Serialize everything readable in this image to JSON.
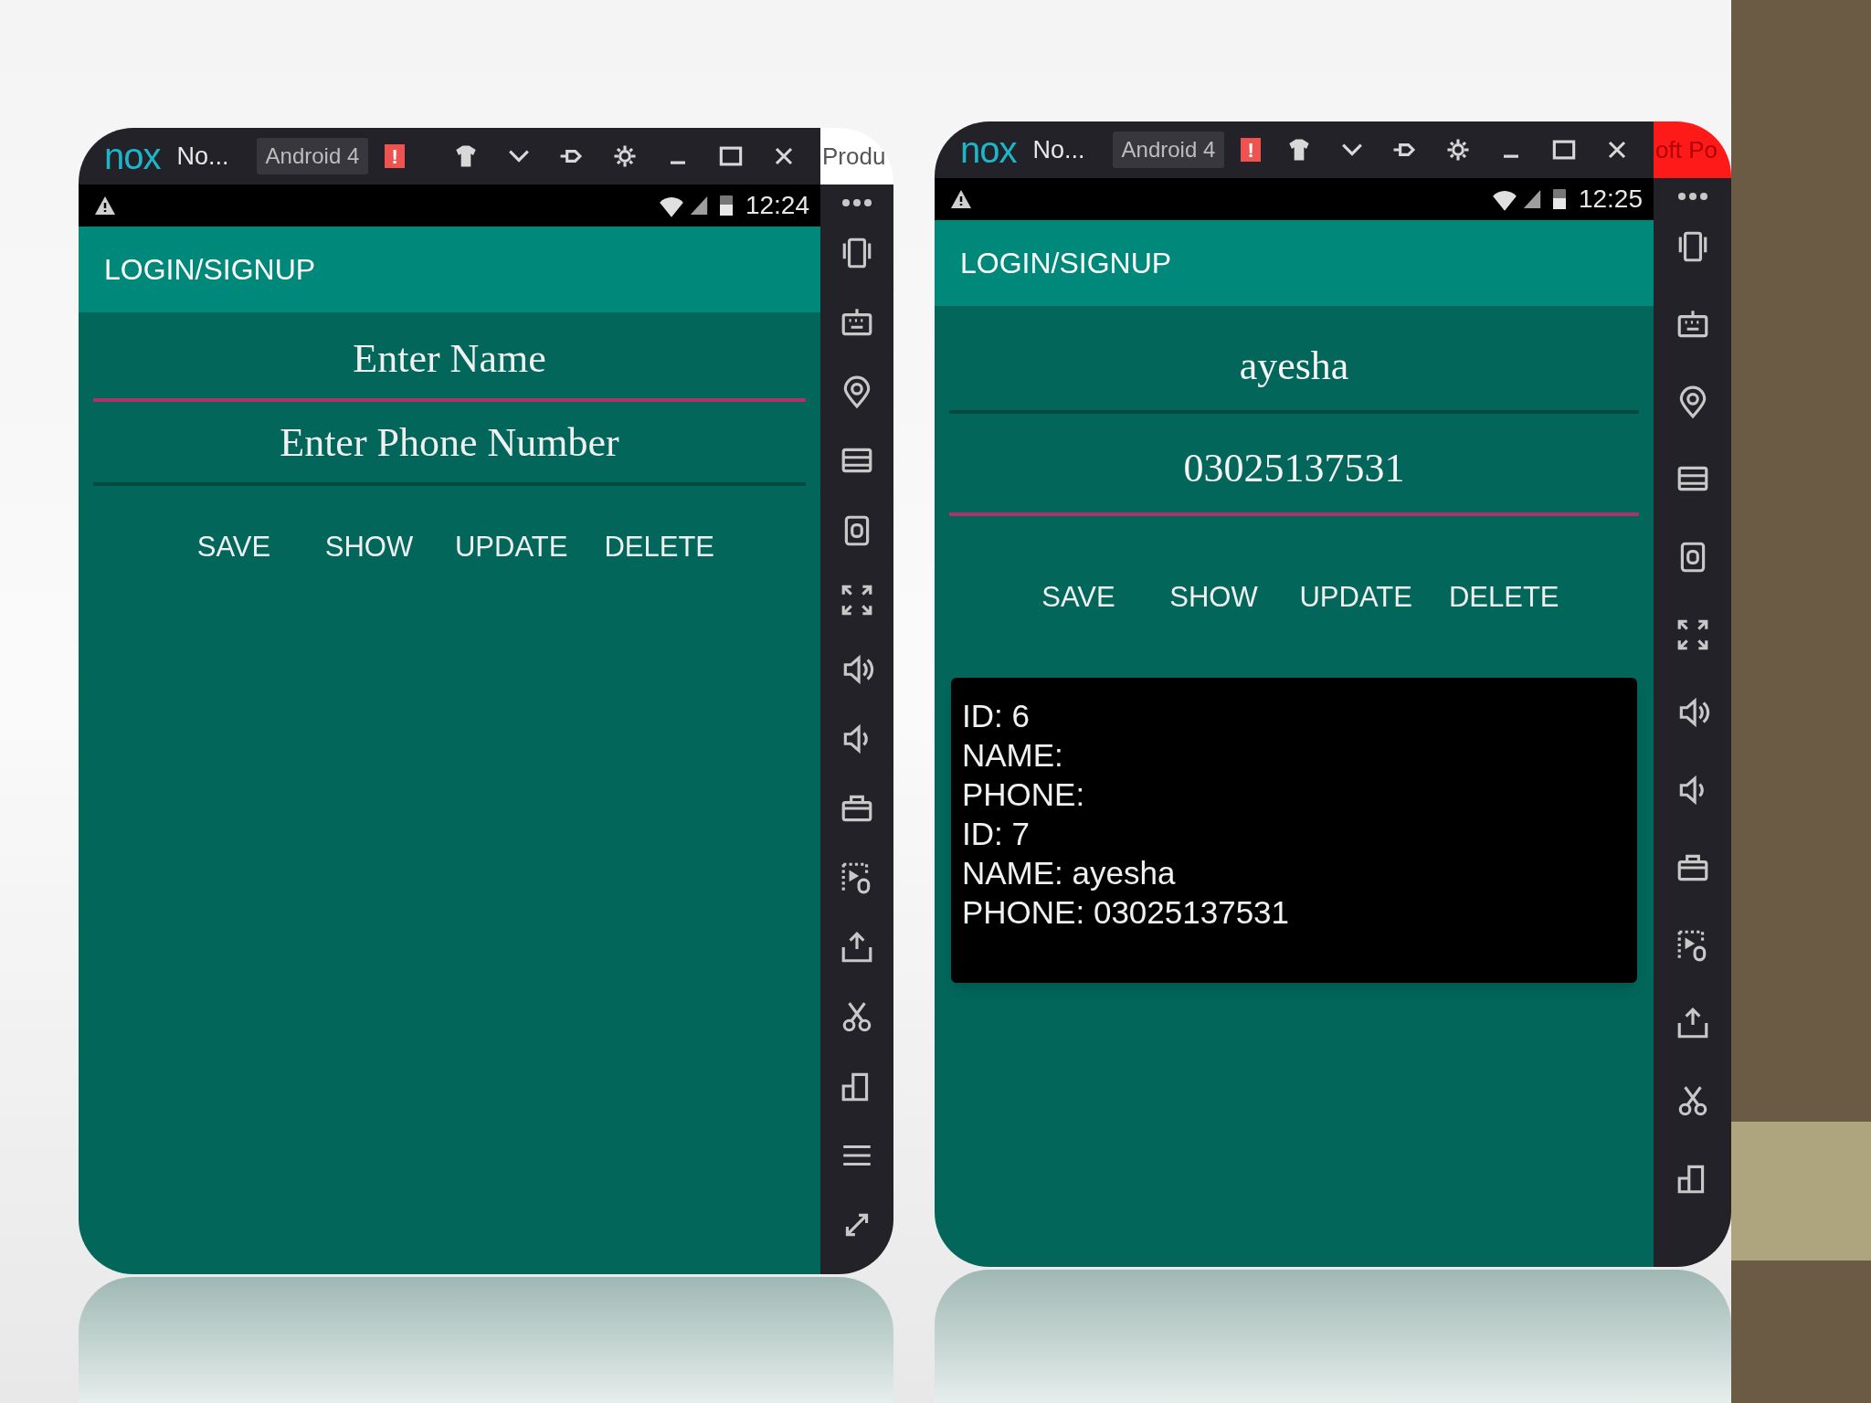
{
  "windows": [
    {
      "logo": "nox",
      "title": "No...",
      "badge": "Android 4",
      "alert": "!",
      "behind_tab": {
        "text": "Produ",
        "color": "#ffffff"
      },
      "time": "12:24",
      "app_title": "LOGIN/SIGNUP",
      "fields": [
        {
          "placeholder": "Enter Name",
          "focused": true
        },
        {
          "placeholder": "Enter Phone Number",
          "focused": false
        }
      ],
      "buttons": [
        "SAVE",
        "SHOW",
        "UPDATE",
        "DELETE"
      ]
    },
    {
      "logo": "nox",
      "title": "No...",
      "badge": "Android 4",
      "alert": "!",
      "behind_tab": {
        "text": "oft Po",
        "color": "#ff1a1a"
      },
      "time": "12:25",
      "app_title": "LOGIN/SIGNUP",
      "fields": [
        {
          "value": "ayesha",
          "focused": false
        },
        {
          "value": "03025137531",
          "focused": true
        }
      ],
      "buttons": [
        "SAVE",
        "SHOW",
        "UPDATE",
        "DELETE"
      ],
      "result_lines": [
        "ID: 6",
        "NAME:",
        "PHONE:",
        "ID: 7",
        "NAME: ayesha",
        "PHONE: 03025137531"
      ]
    }
  ]
}
